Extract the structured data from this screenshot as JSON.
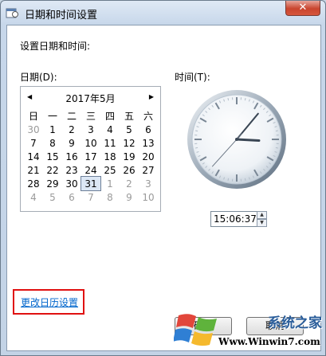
{
  "window": {
    "title": "日期和时间设置",
    "close_glyph": "✕"
  },
  "heading": "设置日期和时间:",
  "date_label": "日期(D):",
  "time_label": "时间(T):",
  "calendar": {
    "month_title": "2017年5月",
    "prev_glyph": "◀",
    "next_glyph": "▶",
    "weekdays": [
      "日",
      "一",
      "二",
      "三",
      "四",
      "五",
      "六"
    ],
    "weeks": [
      [
        "30",
        "1",
        "2",
        "3",
        "4",
        "5",
        "6"
      ],
      [
        "7",
        "8",
        "9",
        "10",
        "11",
        "12",
        "13"
      ],
      [
        "14",
        "15",
        "16",
        "17",
        "18",
        "19",
        "20"
      ],
      [
        "21",
        "22",
        "23",
        "24",
        "25",
        "26",
        "27"
      ],
      [
        "28",
        "29",
        "30",
        "31",
        "1",
        "2",
        "3"
      ],
      [
        "4",
        "5",
        "6",
        "7",
        "8",
        "9",
        "10"
      ]
    ],
    "selected_day": "31"
  },
  "clock": {
    "hour": 15,
    "minute": 6,
    "second": 37
  },
  "time_value": "15:06:37",
  "change_calendar_link": "更改日历设置",
  "buttons": {
    "ok": "确定",
    "cancel": "取消"
  },
  "watermark": {
    "line1": "系统之家",
    "line2": "Www.Winwin7.com"
  },
  "colors": {
    "link": "#0066cc",
    "highlight": "#e01010",
    "close": "#c9452e"
  }
}
